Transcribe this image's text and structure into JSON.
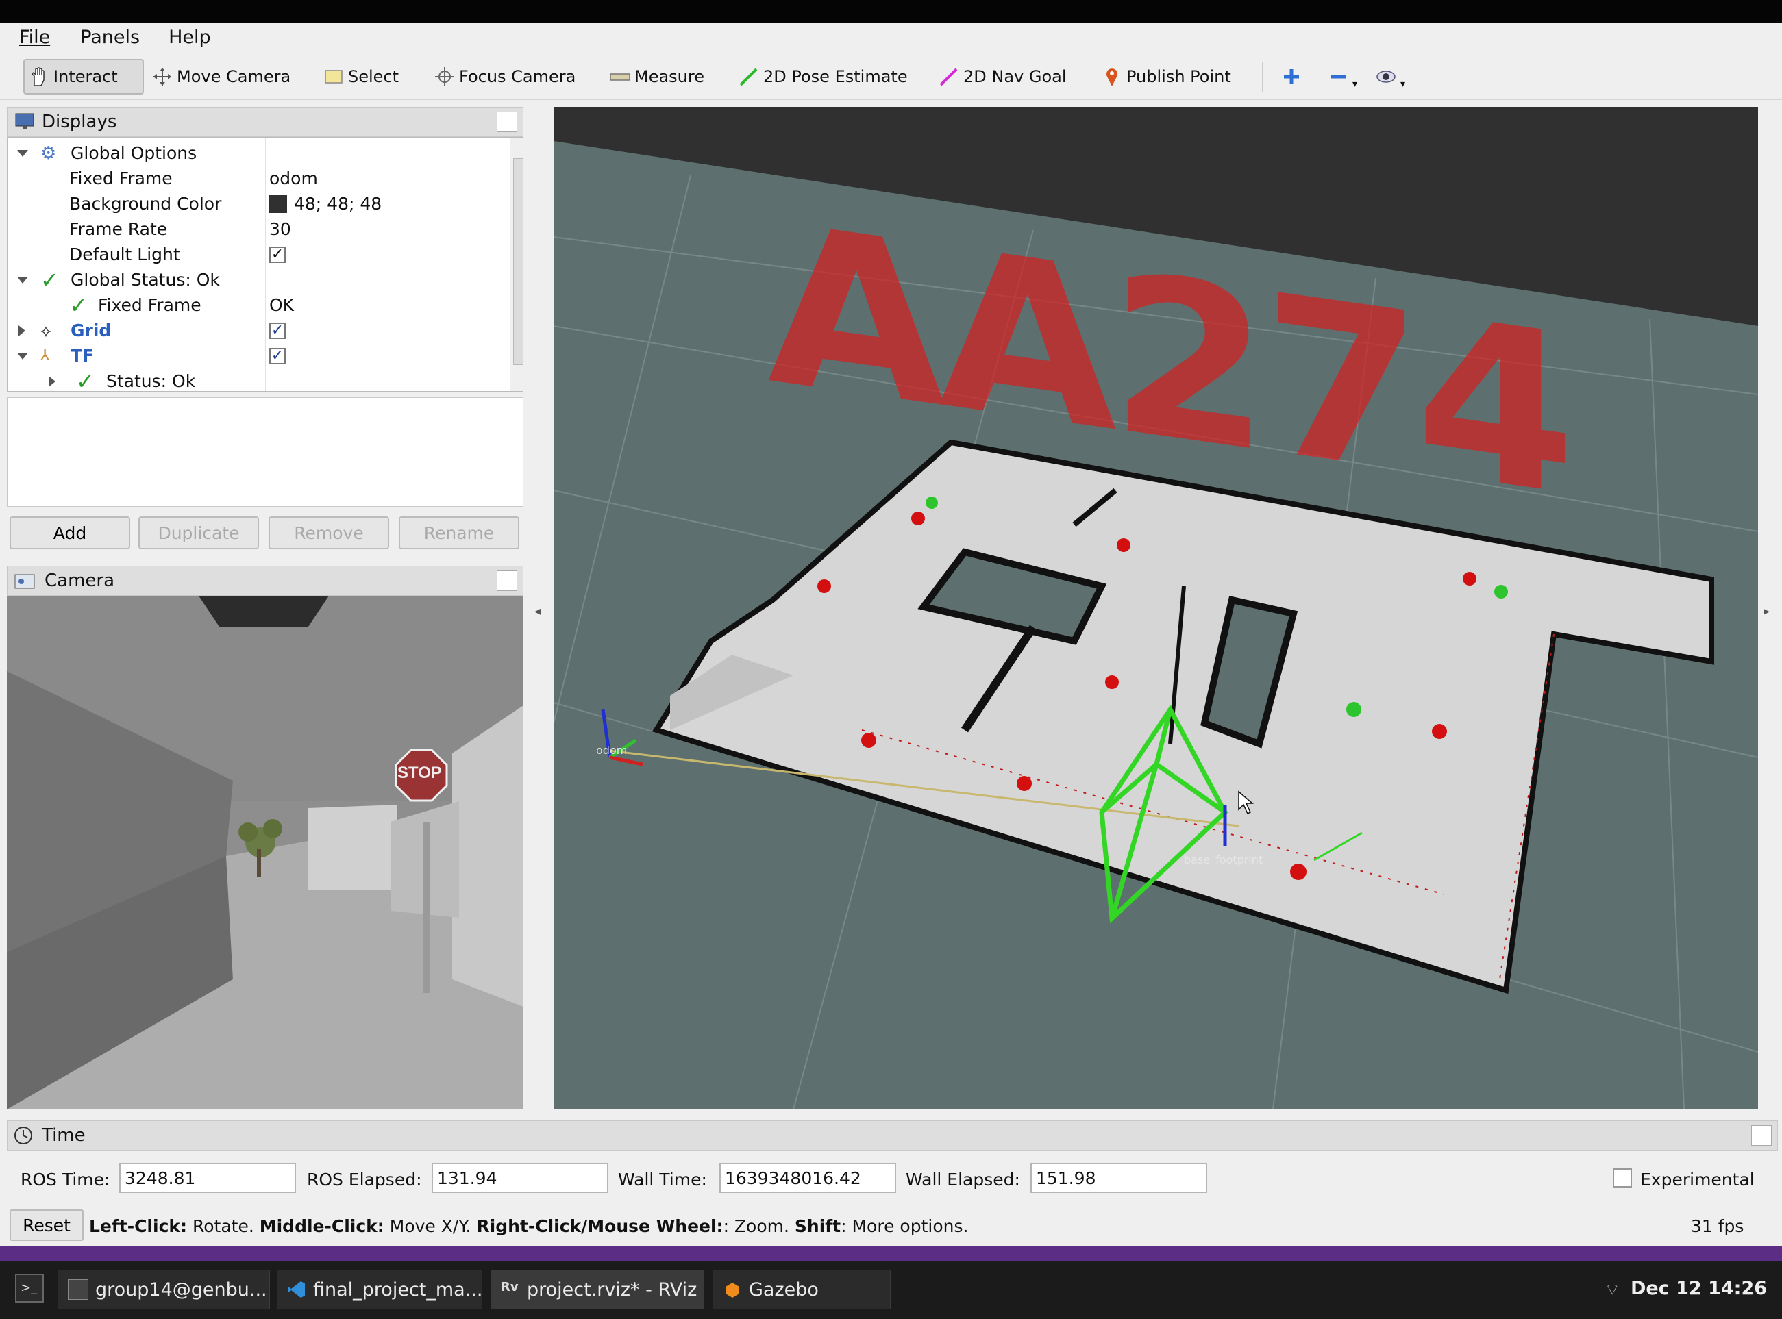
{
  "menubar": {
    "file": "File",
    "panels": "Panels",
    "help": "Help"
  },
  "toolbar": {
    "interact": "Interact",
    "move_camera": "Move Camera",
    "select": "Select",
    "focus_camera": "Focus Camera",
    "measure": "Measure",
    "pose_estimate": "2D Pose Estimate",
    "nav_goal": "2D Nav Goal",
    "publish_point": "Publish Point"
  },
  "displays": {
    "title": "Displays",
    "rows": [
      {
        "label": "Global Options"
      },
      {
        "label": "Fixed Frame",
        "value": "odom"
      },
      {
        "label": "Background Color",
        "value": "48; 48; 48"
      },
      {
        "label": "Frame Rate",
        "value": "30"
      },
      {
        "label": "Default Light",
        "value": "✓"
      },
      {
        "label": "Global Status: Ok"
      },
      {
        "label": "Fixed Frame",
        "value": "OK"
      },
      {
        "label": "Grid",
        "value": "✓"
      },
      {
        "label": "TF",
        "value": "✓"
      },
      {
        "label": "Status: Ok"
      }
    ],
    "buttons": {
      "add": "Add",
      "duplicate": "Duplicate",
      "remove": "Remove",
      "rename": "Rename"
    }
  },
  "camera": {
    "title": "Camera",
    "stop_sign": "STOP"
  },
  "view3d": {
    "marker_text": "AA274",
    "frame_odom": "odom",
    "frame_base": "base_footprint",
    "colors": {
      "background": "#5d706f",
      "map_free": "#d6d6d6",
      "marker_text": "#d42020",
      "robot": "#34d626",
      "goal_red": "#d40f0f",
      "goal_green": "#2ec42e"
    }
  },
  "time": {
    "title": "Time",
    "ros_time_label": "ROS Time:",
    "ros_time": "3248.81",
    "ros_elapsed_label": "ROS Elapsed:",
    "ros_elapsed": "131.94",
    "wall_time_label": "Wall Time:",
    "wall_time": "1639348016.42",
    "wall_elapsed_label": "Wall Elapsed:",
    "wall_elapsed": "151.98",
    "experimental": "Experimental",
    "reset": "Reset",
    "help_leftclick": "Left-Click:",
    "help_rotate": " Rotate. ",
    "help_middleclick": "Middle-Click:",
    "help_movexy": " Move X/Y. ",
    "help_rightclick": "Right-Click/Mouse Wheel:",
    "help_zoom": ": Zoom. ",
    "help_shift": "Shift",
    "help_more": ": More options.",
    "fps": "31 fps"
  },
  "taskbar": {
    "items": [
      "group14@genbu...",
      "final_project_ma...",
      "project.rviz* - RViz",
      "Gazebo"
    ],
    "clock": "Dec 12 14:26"
  }
}
